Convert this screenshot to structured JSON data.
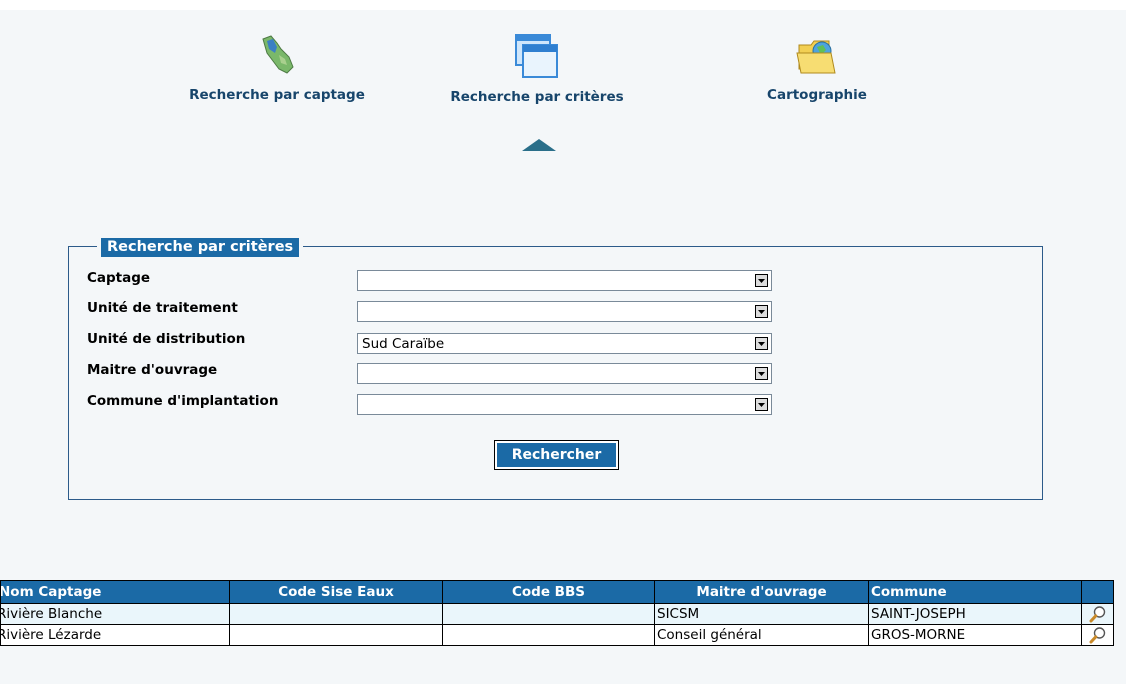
{
  "nav": {
    "captage_label": "Recherche par captage",
    "criteres_label": "Recherche par critères",
    "cartographie_label": "Cartographie",
    "icons": [
      "map-icon",
      "window-icon",
      "folder-globe-icon"
    ],
    "active": "criteres"
  },
  "form": {
    "legend": "Recherche par critères",
    "fields": [
      {
        "label": "Captage",
        "value": ""
      },
      {
        "label": "Unité de traitement",
        "value": ""
      },
      {
        "label": "Unité de distribution",
        "value": "Sud Caraïbe"
      },
      {
        "label": "Maitre d'ouvrage",
        "value": ""
      },
      {
        "label": "Commune d'implantation",
        "value": ""
      }
    ],
    "submit_label": "Rechercher"
  },
  "results": {
    "headers": [
      "Nom Captage",
      "Code Sise Eaux",
      "Code BBS",
      "Maitre d'ouvrage",
      "Commune",
      ""
    ],
    "rows": [
      {
        "nom": "Rivière Blanche",
        "code_sise": "",
        "code_bbs": "",
        "maitre": "SICSM",
        "commune": "SAINT-JOSEPH"
      },
      {
        "nom": "Rivière Lézarde",
        "code_sise": "",
        "code_bbs": "",
        "maitre": "Conseil général",
        "commune": "GROS-MORNE"
      }
    ]
  },
  "colors": {
    "accent": "#1b6aa6",
    "nav_text": "#17456b",
    "panel_bg": "#f4f7f9"
  }
}
